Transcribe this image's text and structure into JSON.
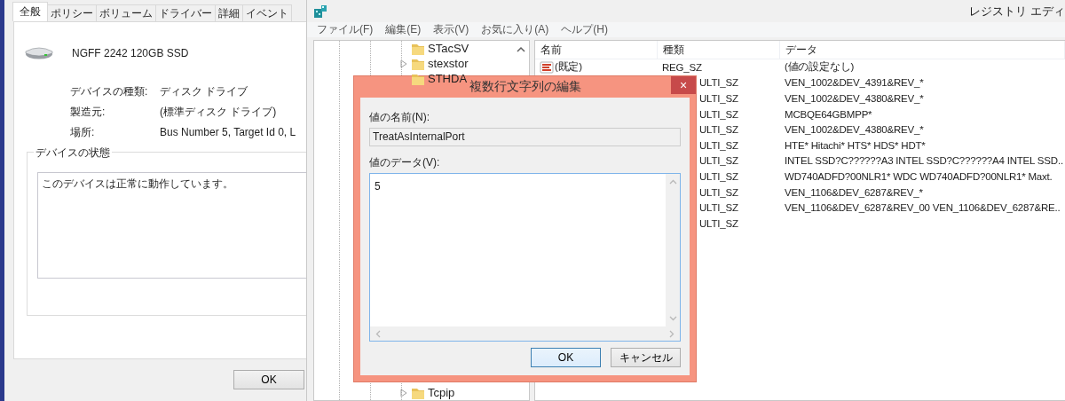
{
  "properties_window": {
    "tabs": [
      {
        "label": "全般",
        "selected": true
      },
      {
        "label": "ポリシー",
        "selected": false
      },
      {
        "label": "ボリューム",
        "selected": false
      },
      {
        "label": "ドライバー",
        "selected": false
      },
      {
        "label": "詳細",
        "selected": false
      },
      {
        "label": "イベント",
        "selected": false
      }
    ],
    "device_name": "NGFF 2242 120GB SSD",
    "fields": [
      {
        "label": "デバイスの種類:",
        "value": "ディスク ドライブ"
      },
      {
        "label": "製造元:",
        "value": "(標準ディスク ドライブ)"
      },
      {
        "label": "場所:",
        "value": "Bus Number 5, Target Id 0, L"
      }
    ],
    "status_group": {
      "title": "デバイスの状態",
      "text": "このデバイスは正常に動作しています。"
    },
    "buttons": [
      "OK"
    ]
  },
  "registry_editor": {
    "title": "レジストリ エディ",
    "menu": [
      "ファイル(F)",
      "編集(E)",
      "表示(V)",
      "お気に入り(A)",
      "ヘルプ(H)"
    ],
    "tree": {
      "top_items": [
        {
          "label": "STacSV",
          "expandable": false
        },
        {
          "label": "stexstor",
          "expandable": true
        },
        {
          "label": "STHDA",
          "expandable": false
        }
      ],
      "bottom_items": [
        {
          "label": "Tcpip",
          "expandable": true
        }
      ]
    },
    "values": {
      "columns": [
        "名前",
        "種類",
        "データ"
      ],
      "rows": [
        {
          "name": "(既定)",
          "type": "REG_SZ",
          "data": "(値の設定なし)"
        },
        {
          "type": "ULTI_SZ",
          "data": "VEN_1002&DEV_4391&REV_*"
        },
        {
          "type": "ULTI_SZ",
          "data": "VEN_1002&DEV_4380&REV_*"
        },
        {
          "type": "ULTI_SZ",
          "data": "MCBQE64GBMPP*"
        },
        {
          "type": "ULTI_SZ",
          "data": "VEN_1002&DEV_4380&REV_*"
        },
        {
          "type": "ULTI_SZ",
          "data": "HTE* Hitachi* HTS* HDS* HDT*"
        },
        {
          "type": "ULTI_SZ",
          "data": "INTEL SSD?C??????A3 INTEL SSD?C??????A4 INTEL SSD.."
        },
        {
          "type": "ULTI_SZ",
          "data": "WD740ADFD?00NLR1* WDC WD740ADFD?00NLR1* Maxt."
        },
        {
          "type": "ULTI_SZ",
          "data": "VEN_1106&DEV_6287&REV_*"
        },
        {
          "type": "ULTI_SZ",
          "data": "VEN_1106&DEV_6287&REV_00 VEN_1106&DEV_6287&RE.."
        },
        {
          "type": "ULTI_SZ"
        }
      ]
    }
  },
  "dialog": {
    "title": "複数行文字列の編集",
    "close_button": "×",
    "name_label": "値の名前(N):",
    "name_value": "TreatAsInternalPort",
    "data_label": "値のデータ(V):",
    "data_value": "5",
    "buttons": [
      {
        "label": "OK",
        "default": true
      },
      {
        "label": "キャンセル",
        "default": false
      }
    ]
  }
}
